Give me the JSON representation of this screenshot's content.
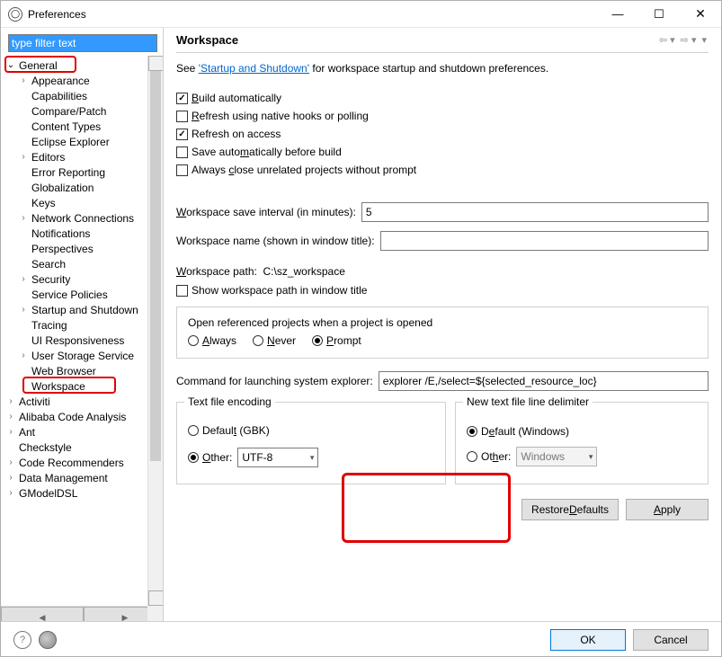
{
  "window": {
    "title": "Preferences"
  },
  "filter": {
    "value": "type filter text"
  },
  "tree": {
    "items": [
      {
        "label": "General",
        "depth": 0,
        "arrow": "open"
      },
      {
        "label": "Appearance",
        "depth": 1,
        "arrow": "closed"
      },
      {
        "label": "Capabilities",
        "depth": 1,
        "arrow": ""
      },
      {
        "label": "Compare/Patch",
        "depth": 1,
        "arrow": ""
      },
      {
        "label": "Content Types",
        "depth": 1,
        "arrow": ""
      },
      {
        "label": "Eclipse Explorer",
        "depth": 1,
        "arrow": ""
      },
      {
        "label": "Editors",
        "depth": 1,
        "arrow": "closed"
      },
      {
        "label": "Error Reporting",
        "depth": 1,
        "arrow": ""
      },
      {
        "label": "Globalization",
        "depth": 1,
        "arrow": ""
      },
      {
        "label": "Keys",
        "depth": 1,
        "arrow": ""
      },
      {
        "label": "Network Connections",
        "depth": 1,
        "arrow": "closed"
      },
      {
        "label": "Notifications",
        "depth": 1,
        "arrow": ""
      },
      {
        "label": "Perspectives",
        "depth": 1,
        "arrow": ""
      },
      {
        "label": "Search",
        "depth": 1,
        "arrow": ""
      },
      {
        "label": "Security",
        "depth": 1,
        "arrow": "closed"
      },
      {
        "label": "Service Policies",
        "depth": 1,
        "arrow": ""
      },
      {
        "label": "Startup and Shutdown",
        "depth": 1,
        "arrow": "closed"
      },
      {
        "label": "Tracing",
        "depth": 1,
        "arrow": ""
      },
      {
        "label": "UI Responsiveness",
        "depth": 1,
        "arrow": ""
      },
      {
        "label": "User Storage Service",
        "depth": 1,
        "arrow": "closed"
      },
      {
        "label": "Web Browser",
        "depth": 1,
        "arrow": ""
      },
      {
        "label": "Workspace",
        "depth": 1,
        "arrow": "closed"
      },
      {
        "label": "Activiti",
        "depth": 0,
        "arrow": "closed"
      },
      {
        "label": "Alibaba Code Analysis",
        "depth": 0,
        "arrow": "closed"
      },
      {
        "label": "Ant",
        "depth": 0,
        "arrow": "closed"
      },
      {
        "label": "Checkstyle",
        "depth": 0,
        "arrow": ""
      },
      {
        "label": "Code Recommenders",
        "depth": 0,
        "arrow": "closed"
      },
      {
        "label": "Data Management",
        "depth": 0,
        "arrow": "closed"
      },
      {
        "label": "GModelDSL",
        "depth": 0,
        "arrow": "closed"
      }
    ]
  },
  "page": {
    "title": "Workspace",
    "intro_prefix": "See ",
    "intro_link": "'Startup and Shutdown'",
    "intro_suffix": " for workspace startup and shutdown preferences.",
    "checkboxes": {
      "build_auto": "Build automatically",
      "refresh_hooks": "Refresh using native hooks or polling",
      "refresh_access": "Refresh on access",
      "save_before_build": "Save automatically before build",
      "close_unrelated": "Always close unrelated projects without prompt"
    },
    "save_interval_label": "Workspace save interval (in minutes):",
    "save_interval_value": "5",
    "ws_name_label": "Workspace name (shown in window title):",
    "ws_name_value": "",
    "ws_path_label": "Workspace path:",
    "ws_path_value": "C:\\sz_workspace",
    "show_ws_path": "Show workspace path in window title",
    "open_ref_title": "Open referenced projects when a project is opened",
    "open_ref_always": "Always",
    "open_ref_never": "Never",
    "open_ref_prompt": "Prompt",
    "cmd_explorer_label": "Command for launching system explorer:",
    "cmd_explorer_value": "explorer /E,/select=${selected_resource_loc}",
    "enc_title": "Text file encoding",
    "enc_default": "Default (GBK)",
    "enc_other": "Other:",
    "enc_other_value": "UTF-8",
    "delim_title": "New text file line delimiter",
    "delim_default": "Default (Windows)",
    "delim_other": "Other:",
    "delim_other_value": "Windows",
    "restore_defaults": "Restore Defaults",
    "apply": "Apply"
  },
  "dialog": {
    "ok": "OK",
    "cancel": "Cancel"
  }
}
